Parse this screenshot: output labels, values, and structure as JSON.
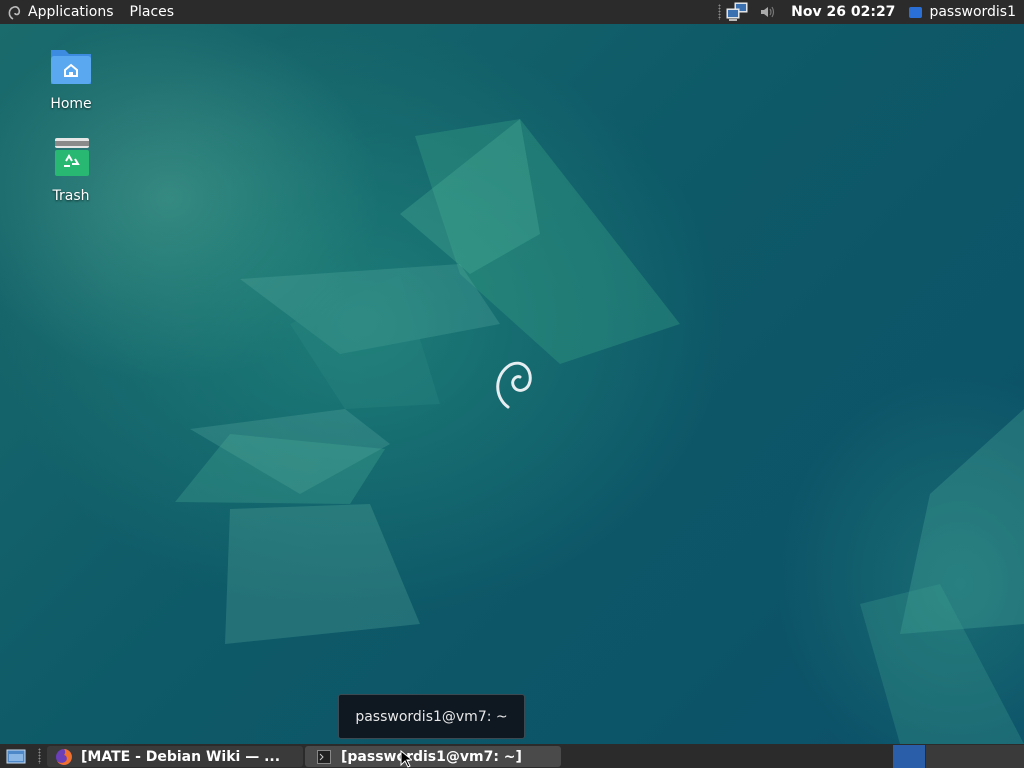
{
  "top_panel": {
    "applications_label": "Applications",
    "places_label": "Places",
    "clock": "Nov 26  02:27",
    "user": "passwordis1"
  },
  "desktop": {
    "icons": [
      {
        "label": "Home",
        "icon": "home-folder-icon"
      },
      {
        "label": "Trash",
        "icon": "trash-icon"
      }
    ],
    "center_logo": "debian-swirl-logo"
  },
  "tooltip": {
    "text": "passwordis1@vm7: ~"
  },
  "bottom_panel": {
    "tasks": [
      {
        "label": "[MATE - Debian Wiki — ...",
        "icon": "firefox-icon"
      },
      {
        "label": "[passwordis1@vm7: ~]",
        "icon": "terminal-icon"
      }
    ]
  },
  "colors": {
    "panel_bg": "#2b2b2b",
    "workspace_active": "#2a5ea8",
    "desktop_teal": "#0f5a63"
  }
}
